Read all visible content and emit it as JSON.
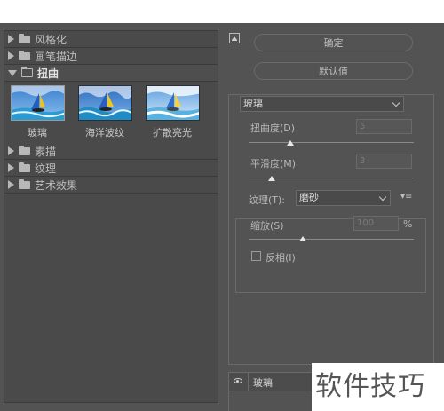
{
  "categories": [
    {
      "label": "风格化",
      "expanded": false
    },
    {
      "label": "画笔描边",
      "expanded": false
    },
    {
      "label": "扭曲",
      "expanded": true
    },
    {
      "label": "素描",
      "expanded": false
    },
    {
      "label": "纹理",
      "expanded": false
    },
    {
      "label": "艺术效果",
      "expanded": false
    }
  ],
  "distort_filters": [
    {
      "label": "玻璃",
      "selected": true
    },
    {
      "label": "海洋波纹",
      "selected": false
    },
    {
      "label": "扩散亮光",
      "selected": false
    }
  ],
  "buttons": {
    "ok": "确定",
    "default": "默认值"
  },
  "filter_select": {
    "value": "玻璃"
  },
  "params": {
    "distortion": {
      "label": "扭曲度(D)",
      "value": "5",
      "slider_fraction": 0.25
    },
    "smoothness": {
      "label": "平滑度(M)",
      "value": "3",
      "slider_fraction": 0.14
    }
  },
  "texture": {
    "label": "纹理(T):",
    "value": "磨砂",
    "menu_icon": "panel-menu-icon",
    "scaling": {
      "label": "缩放(S)",
      "value": "100",
      "unit": "%",
      "slider_fraction": 0.33
    },
    "invert": {
      "label": "反相(I)",
      "checked": false
    }
  },
  "layers": [
    {
      "label": "玻璃",
      "visible": true
    }
  ],
  "watermark": "软件技巧",
  "colors": {
    "panel_bg": "#535353",
    "list_bg": "#4a4a4a",
    "border": "#6a6a6a",
    "text": "#c8c8c8"
  }
}
